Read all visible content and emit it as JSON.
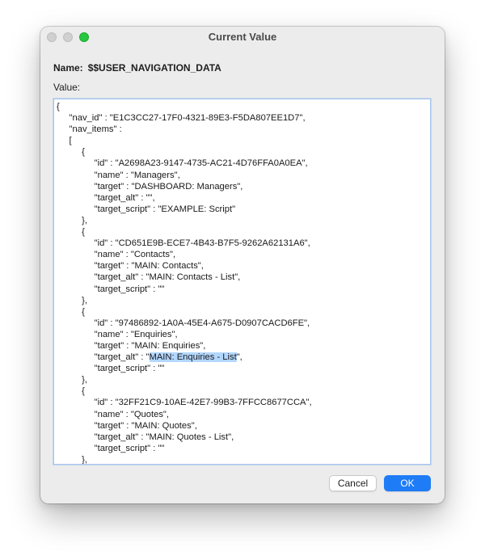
{
  "window": {
    "title": "Current Value",
    "buttons": {
      "close": "close",
      "minimize": "minimize",
      "zoom": "zoom"
    }
  },
  "name_row": {
    "label": "Name:",
    "value": "$$USER_NAVIGATION_DATA"
  },
  "value_label": "Value:",
  "editor": {
    "before_selection": "{\n\t\"nav_id\" : \"E1C3CC27-17F0-4321-89E3-F5DA807EE1D7\",\n\t\"nav_items\" :\n\t[\n\t\t{\n\t\t\t\"id\" : \"A2698A23-9147-4735-AC21-4D76FFA0A0EA\",\n\t\t\t\"name\" : \"Managers\",\n\t\t\t\"target\" : \"DASHBOARD: Managers\",\n\t\t\t\"target_alt\" : \"\",\n\t\t\t\"target_script\" : \"EXAMPLE: Script\"\n\t\t},\n\t\t{\n\t\t\t\"id\" : \"CD651E9B-ECE7-4B43-B7F5-9262A62131A6\",\n\t\t\t\"name\" : \"Contacts\",\n\t\t\t\"target\" : \"MAIN: Contacts\",\n\t\t\t\"target_alt\" : \"MAIN: Contacts - List\",\n\t\t\t\"target_script\" : \"\"\n\t\t},\n\t\t{\n\t\t\t\"id\" : \"97486892-1A0A-45E4-A675-D0907CACD6FE\",\n\t\t\t\"name\" : \"Enquiries\",\n\t\t\t\"target\" : \"MAIN: Enquiries\",\n\t\t\t\"target_alt\" : \"",
    "selection": "MAIN: Enquiries - List",
    "after_selection": "\",\n\t\t\t\"target_script\" : \"\"\n\t\t},\n\t\t{\n\t\t\t\"id\" : \"32FF21C9-10AE-42E7-99B3-7FFCC8677CCA\",\n\t\t\t\"name\" : \"Quotes\",\n\t\t\t\"target\" : \"MAIN: Quotes\",\n\t\t\t\"target_alt\" : \"MAIN: Quotes - List\",\n\t\t\t\"target_script\" : \"\"\n\t\t},"
  },
  "buttons": {
    "cancel": "Cancel",
    "ok": "OK"
  },
  "colors": {
    "ok_button": "#1e7cf6",
    "selection": "#b3d7ff",
    "zoom_light": "#27c840"
  }
}
